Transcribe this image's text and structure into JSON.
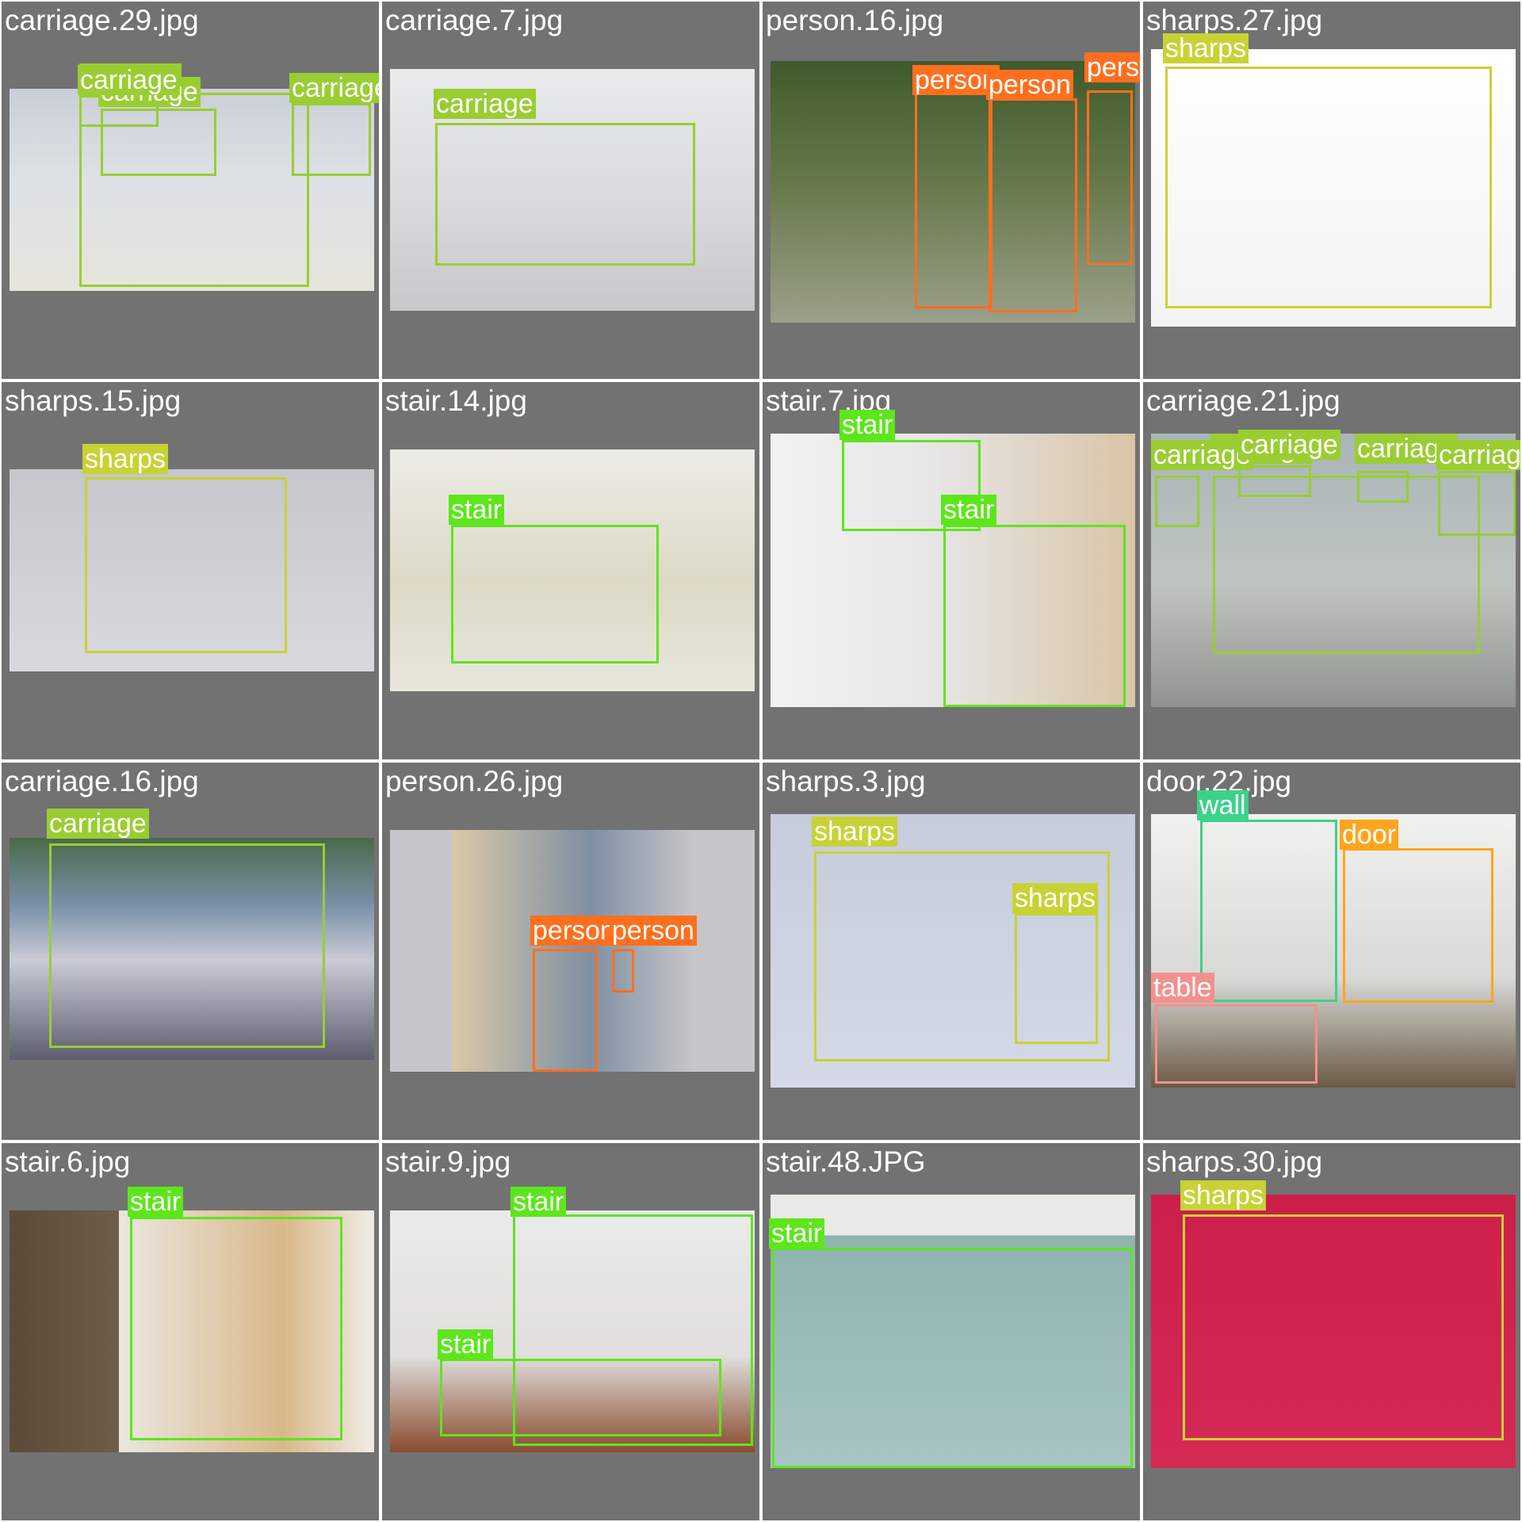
{
  "colors": {
    "carriage": "#9acd32",
    "person": "#ff6f1e",
    "sharps": "#c8d235",
    "stair": "#5de61c",
    "wall": "#3cd28a",
    "door": "#ffa51e",
    "table": "#f3918e"
  },
  "tiles": [
    {
      "filename": "carriage.29.jpg",
      "labels": [
        "carriage",
        "carriage",
        "carriage",
        "carriage"
      ]
    },
    {
      "filename": "carriage.7.jpg",
      "labels": [
        "carriage"
      ]
    },
    {
      "filename": "person.16.jpg",
      "labels": [
        "person",
        "person",
        "person"
      ]
    },
    {
      "filename": "sharps.27.jpg",
      "labels": [
        "sharps"
      ]
    },
    {
      "filename": "sharps.15.jpg",
      "labels": [
        "sharps"
      ]
    },
    {
      "filename": "stair.14.jpg",
      "labels": [
        "stair"
      ]
    },
    {
      "filename": "stair.7.jpg",
      "labels": [
        "stair",
        "stair"
      ]
    },
    {
      "filename": "carriage.21.jpg",
      "labels": [
        "carriage",
        "carriage",
        "carriage",
        "carriage",
        "carriage"
      ]
    },
    {
      "filename": "carriage.16.jpg",
      "labels": [
        "carriage"
      ]
    },
    {
      "filename": "person.26.jpg",
      "labels": [
        "person",
        "person"
      ]
    },
    {
      "filename": "sharps.3.jpg",
      "labels": [
        "sharps",
        "sharps"
      ]
    },
    {
      "filename": "door.22.jpg",
      "labels": [
        "wall",
        "door",
        "table"
      ]
    },
    {
      "filename": "stair.6.jpg",
      "labels": [
        "stair"
      ]
    },
    {
      "filename": "stair.9.jpg",
      "labels": [
        "stair",
        "stair"
      ]
    },
    {
      "filename": "stair.48.JPG",
      "labels": [
        "stair"
      ]
    },
    {
      "filename": "sharps.30.jpg",
      "labels": [
        "sharps"
      ]
    }
  ]
}
